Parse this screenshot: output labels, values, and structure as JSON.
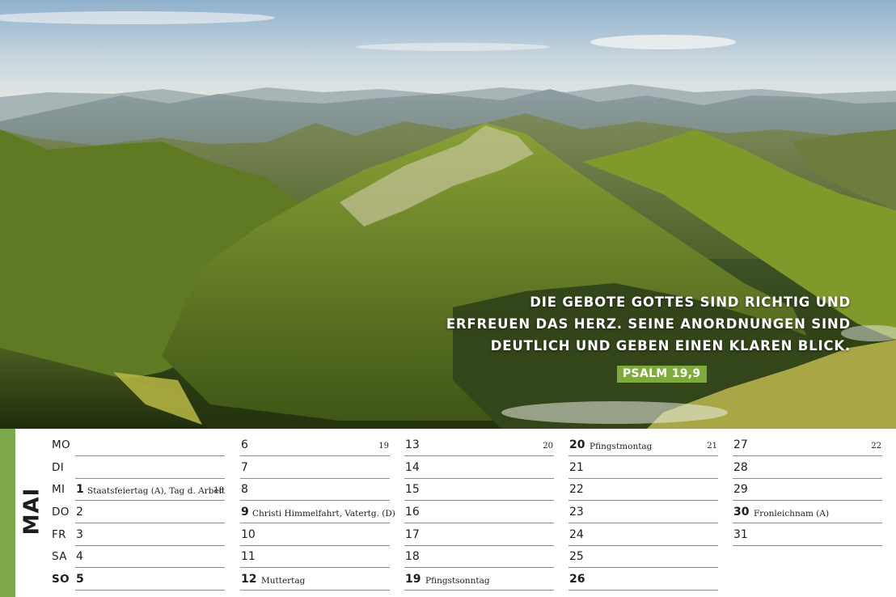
{
  "quote": {
    "line1": "Die Gebote Gottes sind richtig und",
    "line2": "erfreuen das Herz. Seine Anordnungen sind",
    "line3": "deutlich und geben einen klaren Blick.",
    "source": "PSALM 19,9"
  },
  "calendar": {
    "month": "MAI",
    "accent_color": "#7ea94a",
    "weekdays": [
      "MO",
      "DI",
      "MI",
      "DO",
      "FR",
      "SA",
      "SO"
    ],
    "columns": [
      {
        "week_number": "",
        "days": [
          {
            "num": "",
            "holiday": ""
          },
          {
            "num": "",
            "holiday": ""
          },
          {
            "num": "1",
            "holiday": "Staatsfeiertag (A), Tag d. Arbeit",
            "week_number": "18"
          },
          {
            "num": "2",
            "holiday": ""
          },
          {
            "num": "3",
            "holiday": ""
          },
          {
            "num": "4",
            "holiday": ""
          },
          {
            "num": "5",
            "holiday": ""
          }
        ]
      },
      {
        "week_number": "19",
        "days": [
          {
            "num": "6",
            "holiday": ""
          },
          {
            "num": "7",
            "holiday": ""
          },
          {
            "num": "8",
            "holiday": ""
          },
          {
            "num": "9",
            "holiday": "Christi Himmelfahrt, Vatertg. (D)"
          },
          {
            "num": "10",
            "holiday": ""
          },
          {
            "num": "11",
            "holiday": ""
          },
          {
            "num": "12",
            "holiday": "Muttertag"
          }
        ]
      },
      {
        "week_number": "20",
        "days": [
          {
            "num": "13",
            "holiday": ""
          },
          {
            "num": "14",
            "holiday": ""
          },
          {
            "num": "15",
            "holiday": ""
          },
          {
            "num": "16",
            "holiday": ""
          },
          {
            "num": "17",
            "holiday": ""
          },
          {
            "num": "18",
            "holiday": ""
          },
          {
            "num": "19",
            "holiday": "Pfingstsonntag"
          }
        ]
      },
      {
        "week_number": "21",
        "days": [
          {
            "num": "20",
            "holiday": "Pfingstmontag"
          },
          {
            "num": "21",
            "holiday": ""
          },
          {
            "num": "22",
            "holiday": ""
          },
          {
            "num": "23",
            "holiday": ""
          },
          {
            "num": "24",
            "holiday": ""
          },
          {
            "num": "25",
            "holiday": ""
          },
          {
            "num": "26",
            "holiday": ""
          }
        ]
      },
      {
        "week_number": "22",
        "days": [
          {
            "num": "27",
            "holiday": ""
          },
          {
            "num": "28",
            "holiday": ""
          },
          {
            "num": "29",
            "holiday": ""
          },
          {
            "num": "30",
            "holiday": "Fronleichnam (A)"
          },
          {
            "num": "31",
            "holiday": ""
          }
        ]
      }
    ]
  }
}
